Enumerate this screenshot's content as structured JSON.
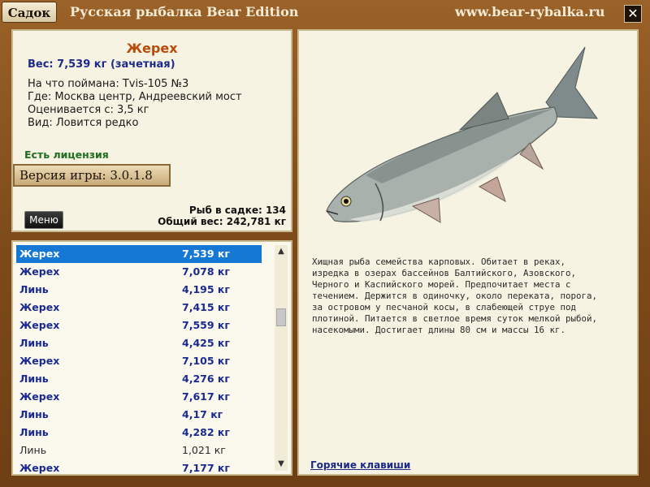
{
  "titlebar": {
    "sadok_label": "Садок",
    "app_title": "Русская рыбалка Bear Edition",
    "site_url": "www.bear-rybalka.ru",
    "close_label": "✕"
  },
  "info": {
    "fish_name": "Жерех",
    "weight_line": "Вес: 7,539 кг (зачетная)",
    "caught_on": "На что поймана: Tvis-105 №3",
    "location": "Где: Москва центр, Андреевский мост",
    "valued_from": "Оценивается с: 3,5 кг",
    "kind": "Вид: Ловится редко",
    "license": "Есть лицензия",
    "version": "Версия игры: 3.0.1.8",
    "menu_label": "Меню",
    "fish_count": "Рыб в садке: 134",
    "total_weight": "Общий вес: 242,781 кг"
  },
  "catch_list": [
    {
      "name": "Жерех",
      "weight": "7,539 кг"
    },
    {
      "name": "Жерех",
      "weight": "7,078 кг"
    },
    {
      "name": "Линь",
      "weight": "4,195 кг"
    },
    {
      "name": "Жерех",
      "weight": "7,415 кг"
    },
    {
      "name": "Жерех",
      "weight": "7,559 кг"
    },
    {
      "name": "Линь",
      "weight": "4,425 кг"
    },
    {
      "name": "Жерех",
      "weight": "7,105 кг"
    },
    {
      "name": "Линь",
      "weight": "4,276 кг"
    },
    {
      "name": "Жерех",
      "weight": "7,617 кг"
    },
    {
      "name": "Линь",
      "weight": "4,17 кг"
    },
    {
      "name": "Линь",
      "weight": "4,282 кг"
    },
    {
      "name": "Линь",
      "weight": "1,021 кг"
    },
    {
      "name": "Жерех",
      "weight": "7,177 кг"
    }
  ],
  "detail": {
    "description_lines": [
      "Хищная рыба семейства карповых. Обитает в реках,",
      "изредка в озерах бассейнов Балтийского, Азовского,",
      "Черного и Каспийского морей. Предпочитает места с",
      "течением. Держится в одиночку, около переката, порога,",
      "за островом у песчаной косы, в слабеющей струе под",
      "плотиной. Питается в светлое время суток мелкой рыбой,",
      "насекомыми. Достигает длины 80 см и массы 16 кг."
    ],
    "hotkeys_label": "Горячие клавиши"
  },
  "icons": {
    "scroll_up": "chevron-up-icon",
    "scroll_down": "chevron-down-icon",
    "close": "close-icon"
  },
  "colors": {
    "frame": "#7d4a1a",
    "panel": "#f7f3e2",
    "selected_row": "#1478d4",
    "fish_name": "#b84a0c",
    "link": "#1c2a8a",
    "license": "#1f6e1f"
  }
}
